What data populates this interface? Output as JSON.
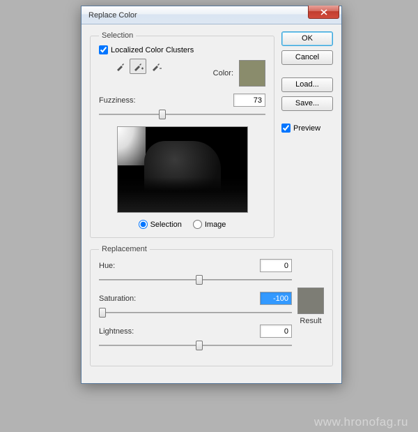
{
  "title": "Replace Color",
  "buttons": {
    "ok": "OK",
    "cancel": "Cancel",
    "load": "Load...",
    "save": "Save..."
  },
  "preview_chk": {
    "label": "Preview",
    "checked": true
  },
  "selection": {
    "legend": "Selection",
    "localized": {
      "label": "Localized Color Clusters",
      "checked": true
    },
    "color_label": "Color:",
    "color_swatch": "#8a8c6c",
    "fuzziness": {
      "label": "Fuzziness:",
      "value": "73",
      "pos": 36
    },
    "mode": {
      "selection": "Selection",
      "image": "Image",
      "picked": "selection"
    }
  },
  "replacement": {
    "legend": "Replacement",
    "hue": {
      "label": "Hue:",
      "value": "0",
      "pos": 50
    },
    "saturation": {
      "label": "Saturation:",
      "value": "-100",
      "pos": 0
    },
    "lightness": {
      "label": "Lightness:",
      "value": "0",
      "pos": 50
    },
    "result_label": "Result",
    "result_swatch": "#7d7d75"
  },
  "watermark": "www.hronofag.ru"
}
